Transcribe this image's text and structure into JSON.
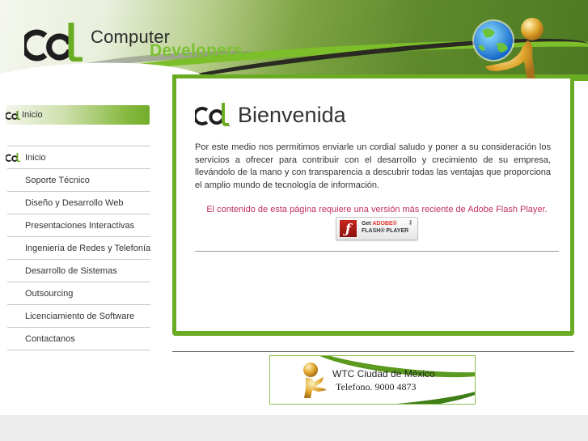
{
  "brand": {
    "name_line1": "Computer",
    "name_line2": "Developers",
    "logo_icon": "cd-logo-icon",
    "hero_icon": "globe-figure-icon",
    "colors": {
      "primary_green": "#6aab24",
      "light_green": "#7cc033",
      "text_dark": "#333333",
      "flash_notice": "#c0305e"
    }
  },
  "sidebar": {
    "active_section": {
      "label": "Inicio",
      "icon": "cd-logo-icon"
    },
    "items": [
      {
        "label": "Inicio",
        "icon": "cd-logo-icon"
      },
      {
        "label": "Soporte Técnico"
      },
      {
        "label": "Diseño y Desarrollo Web"
      },
      {
        "label": "Presentaciones Interactivas"
      },
      {
        "label": "Ingeniería de Redes y Telefonía"
      },
      {
        "label": "Desarrollo de Sistemas"
      },
      {
        "label": "Outsourcing"
      },
      {
        "label": "Licenciamiento de Software"
      },
      {
        "label": "Contactanos"
      }
    ]
  },
  "main": {
    "title": "Bienvenida",
    "title_icon": "cd-logo-icon",
    "intro": "Por este medio nos permitimos enviarle un cordial saludo y poner a su consideración los servicios a ofrecer para contribuir con el desarrollo y crecimiento de su empresa, llevándolo de la mano y con transparencia a descubrir todas las ventajas que proporciona el amplio mundo de tecnología de información.",
    "flash_notice": "El contenido de esta página requiere una versión más reciente de Adobe Flash Player.",
    "flash_button": {
      "get": "Get",
      "adobe": "ADOBE®",
      "player": "FLASH® PLAYER",
      "icon": "flash-logo-icon",
      "arrow_icon": "download-arrow-icon"
    }
  },
  "footer_banner": {
    "line1": "WTC Ciudad de México",
    "line2": "Telefono. 9000 4873",
    "icon": "gold-figure-icon"
  }
}
